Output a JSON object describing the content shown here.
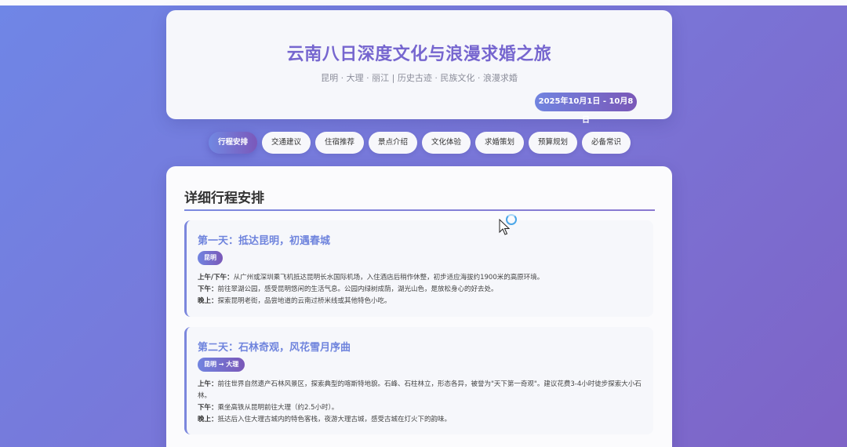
{
  "header": {
    "title": "云南八日深度文化与浪漫求婚之旅",
    "subtitle": "昆明 · 大理 · 丽江 | 历史古迹 · 民族文化 · 浪漫求婚",
    "date": "2025年10月1日 - 10月8日"
  },
  "tabs": [
    {
      "label": "行程安排",
      "active": true
    },
    {
      "label": "交通建议",
      "active": false
    },
    {
      "label": "住宿推荐",
      "active": false
    },
    {
      "label": "景点介绍",
      "active": false
    },
    {
      "label": "文化体验",
      "active": false
    },
    {
      "label": "求婚策划",
      "active": false
    },
    {
      "label": "预算规划",
      "active": false
    },
    {
      "label": "必备常识",
      "active": false
    }
  ],
  "main": {
    "section_title": "详细行程安排",
    "days": [
      {
        "title": "第一天：抵达昆明，初遇春城",
        "location": "昆明",
        "plans": [
          {
            "key": "上午/下午：",
            "text": "从广州或深圳乘飞机抵达昆明长水国际机场，入住酒店后稍作休整，初步适应海拔约1900米的高原环境。"
          },
          {
            "key": "下午：",
            "text": "前往翠湖公园，感受昆明悠闲的生活气息。公园内绿树成荫，湖光山色，是放松身心的好去处。"
          },
          {
            "key": "晚上：",
            "text": "探索昆明老街，品尝地道的云南过桥米线或其他特色小吃。"
          }
        ]
      },
      {
        "title": "第二天：石林奇观，风花雪月序曲",
        "location": "昆明 → 大理",
        "plans": [
          {
            "key": "上午：",
            "text": "前往世界自然遗产石林风景区，探索典型的喀斯特地貌。石峰、石柱林立，形态各异，被誉为\"天下第一奇观\"。建议花费3-4小时徒步探索大小石林。"
          },
          {
            "key": "下午：",
            "text": "乘坐高铁从昆明前往大理（约2.5小时）。"
          },
          {
            "key": "晚上：",
            "text": "抵达后入住大理古城内的特色客栈，夜游大理古城，感受古城在灯火下的韵味。"
          }
        ]
      }
    ]
  }
}
